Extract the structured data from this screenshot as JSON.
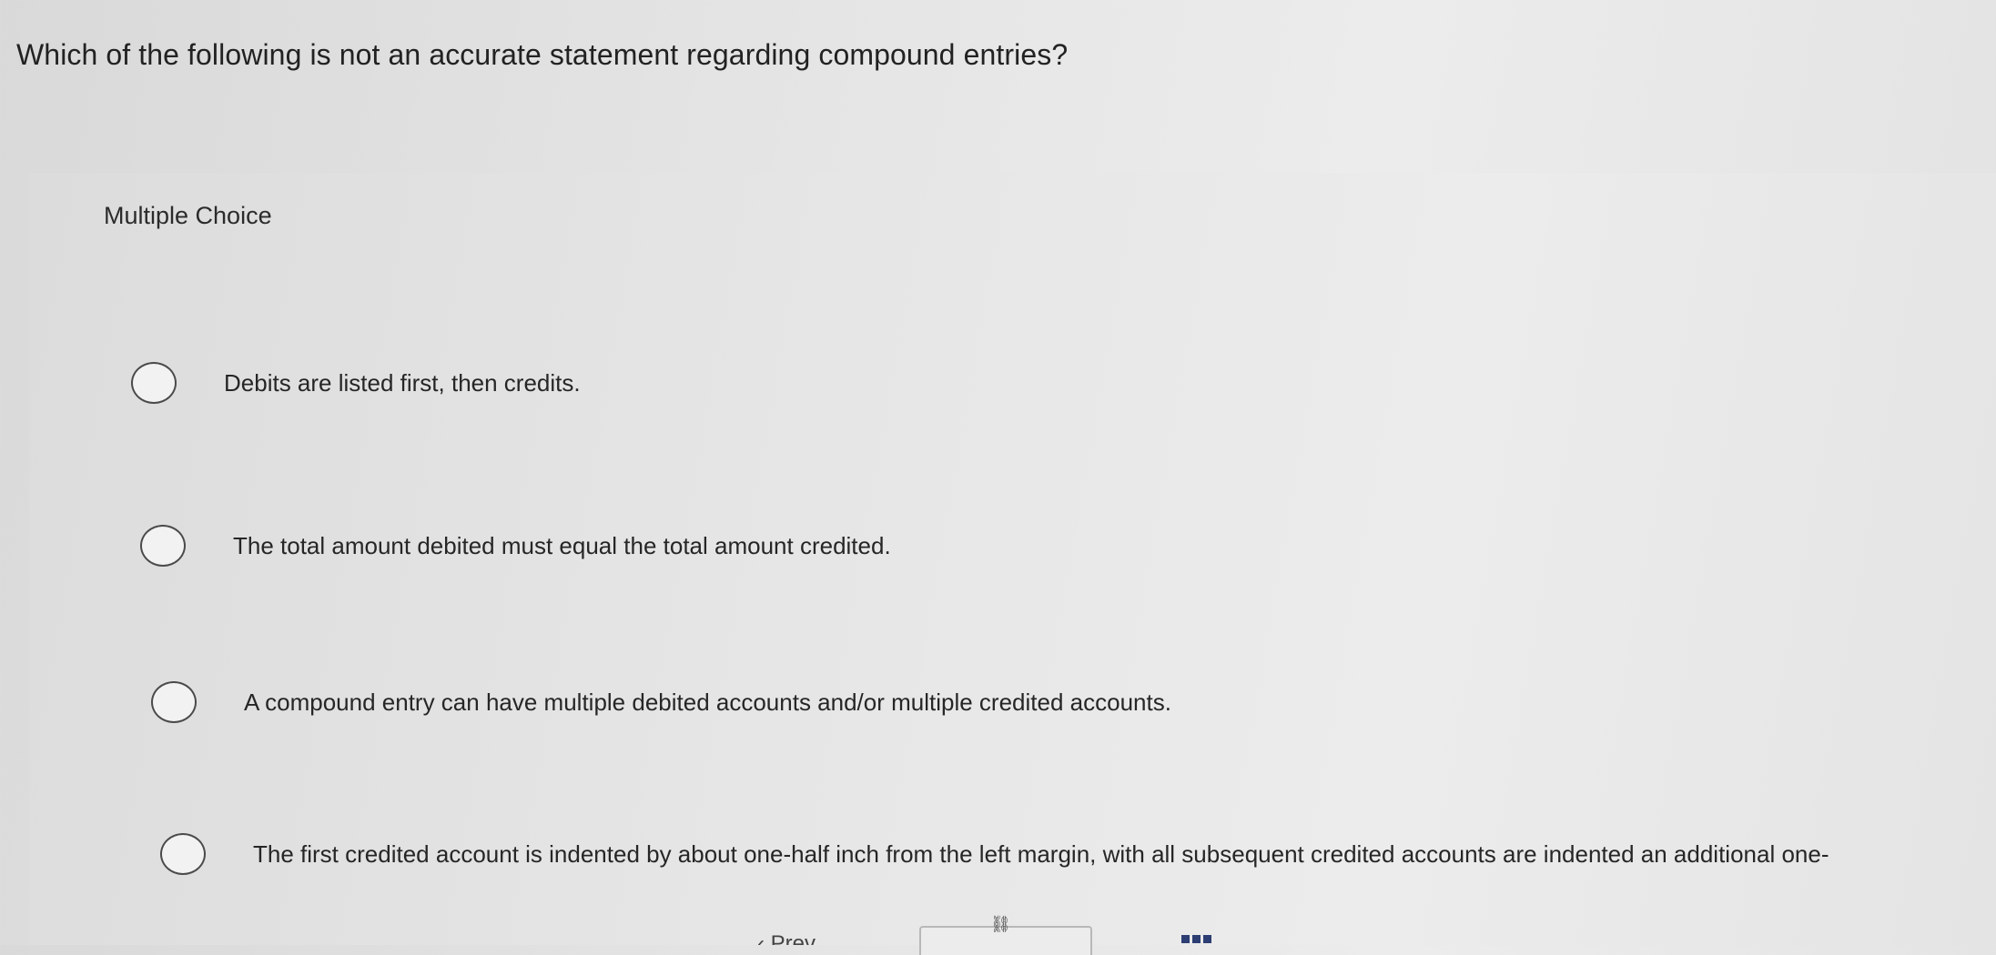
{
  "question": {
    "text": "Which of the following is not an accurate statement regarding compound entries?"
  },
  "choice_section": {
    "label": "Multiple Choice",
    "options": [
      {
        "text": "Debits are listed first, then credits."
      },
      {
        "text": "The total amount debited must equal the total amount credited."
      },
      {
        "text": "A compound entry can have multiple debited accounts and/or multiple credited accounts."
      },
      {
        "text": "The first credited account is indented by about one-half inch from the left margin, with all subsequent credited accounts are indented an additional one-"
      }
    ]
  },
  "bottom_nav": {
    "prev_label": "Prev"
  },
  "icons": {
    "radio": "radio-empty-icon",
    "link": "link-icon",
    "grid": "grid-icon",
    "prev": "chevron-left-icon"
  },
  "colors": {
    "grid_icon": "#2c3e73"
  }
}
